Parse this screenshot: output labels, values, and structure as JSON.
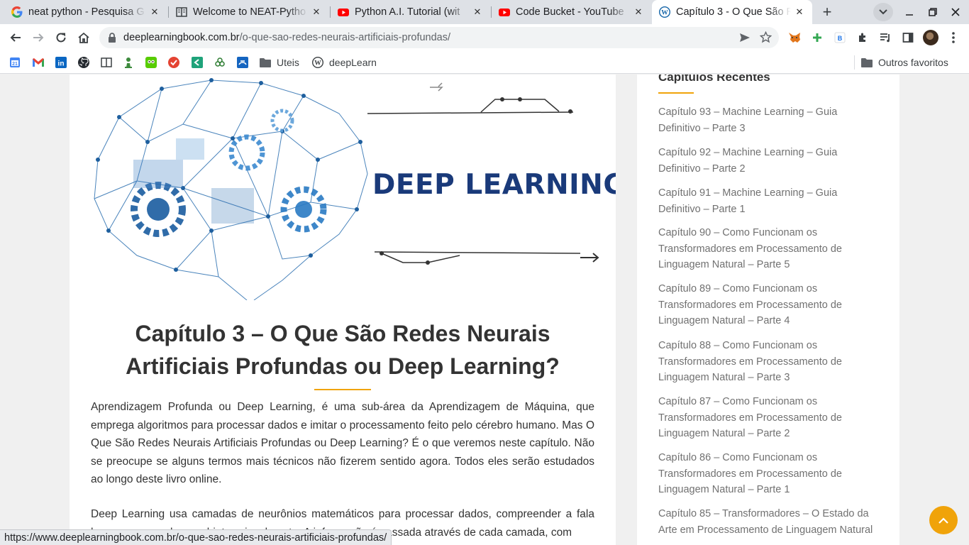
{
  "tabs": [
    {
      "title": "neat python - Pesquisa G",
      "icon": "google-icon"
    },
    {
      "title": "Welcome to NEAT-Pytho",
      "icon": "book-icon"
    },
    {
      "title": "Python A.I. Tutorial (wit",
      "icon": "youtube-icon"
    },
    {
      "title": "Code Bucket - YouTube",
      "icon": "youtube-icon"
    },
    {
      "title": "Capítulo 3 - O Que São R",
      "icon": "wordpress-icon",
      "active": true
    }
  ],
  "omnibox": {
    "host": "deeplearningbook.com.br",
    "path": "/o-que-sao-redes-neurais-artificiais-profundas/"
  },
  "bookmarks": {
    "folder1": "Uteis",
    "item1": "deepLearn",
    "others": "Outros favoritos"
  },
  "article": {
    "hero_text": "DEEP LEARNING",
    "title": "Capítulo 3 – O Que São Redes Neurais Artificiais Profundas ou Deep Learning?",
    "paragraph1": "Aprendizagem Profunda ou Deep Learning, é uma sub-área da Aprendizagem de Máquina, que emprega algoritmos para processar dados e imitar o processamento feito pelo cérebro humano. Mas O Que São Redes Neurais Artificiais Profundas ou Deep Learning? É o que veremos neste capítulo. Não se preocupe se alguns termos mais técnicos não fizerem sentido agora. Todos eles serão estudados ao longo deste livro online.",
    "paragraph2": "Deep Learning  usa camadas de neurônios matemáticos para processar dados, compreender a fala humana e reconhecer objetos visualmente. A informação é passada através de cada camada, com"
  },
  "sidebar": {
    "heading": "Capítulos Recentes",
    "items": [
      "Capítulo 93 – Machine Learning – Guia Definitivo – Parte 3",
      "Capítulo 92 – Machine Learning – Guia Definitivo – Parte 2",
      "Capítulo 91 – Machine Learning – Guia Definitivo – Parte 1",
      "Capítulo 90 – Como Funcionam os Transformadores em Processamento de Linguagem Natural – Parte 5",
      "Capítulo 89 – Como Funcionam os Transformadores em Processamento de Linguagem Natural – Parte 4",
      "Capítulo 88 – Como Funcionam os Transformadores em Processamento de Linguagem Natural – Parte 3",
      "Capítulo 87 – Como Funcionam os Transformadores em Processamento de Linguagem Natural – Parte 2",
      "Capítulo 86 – Como Funcionam os Transformadores em Processamento de Linguagem Natural – Parte 1",
      "Capítulo 85 – Transformadores – O Estado da Arte em Processamento de Linguagem Natural"
    ]
  },
  "status_url": "https://www.deeplearningbook.com.br/o-que-sao-redes-neurais-artificiais-profundas/",
  "colors": {
    "accent": "#f0a30a",
    "hero_text": "#1a3a7a",
    "sidebar_link": "#717171"
  }
}
